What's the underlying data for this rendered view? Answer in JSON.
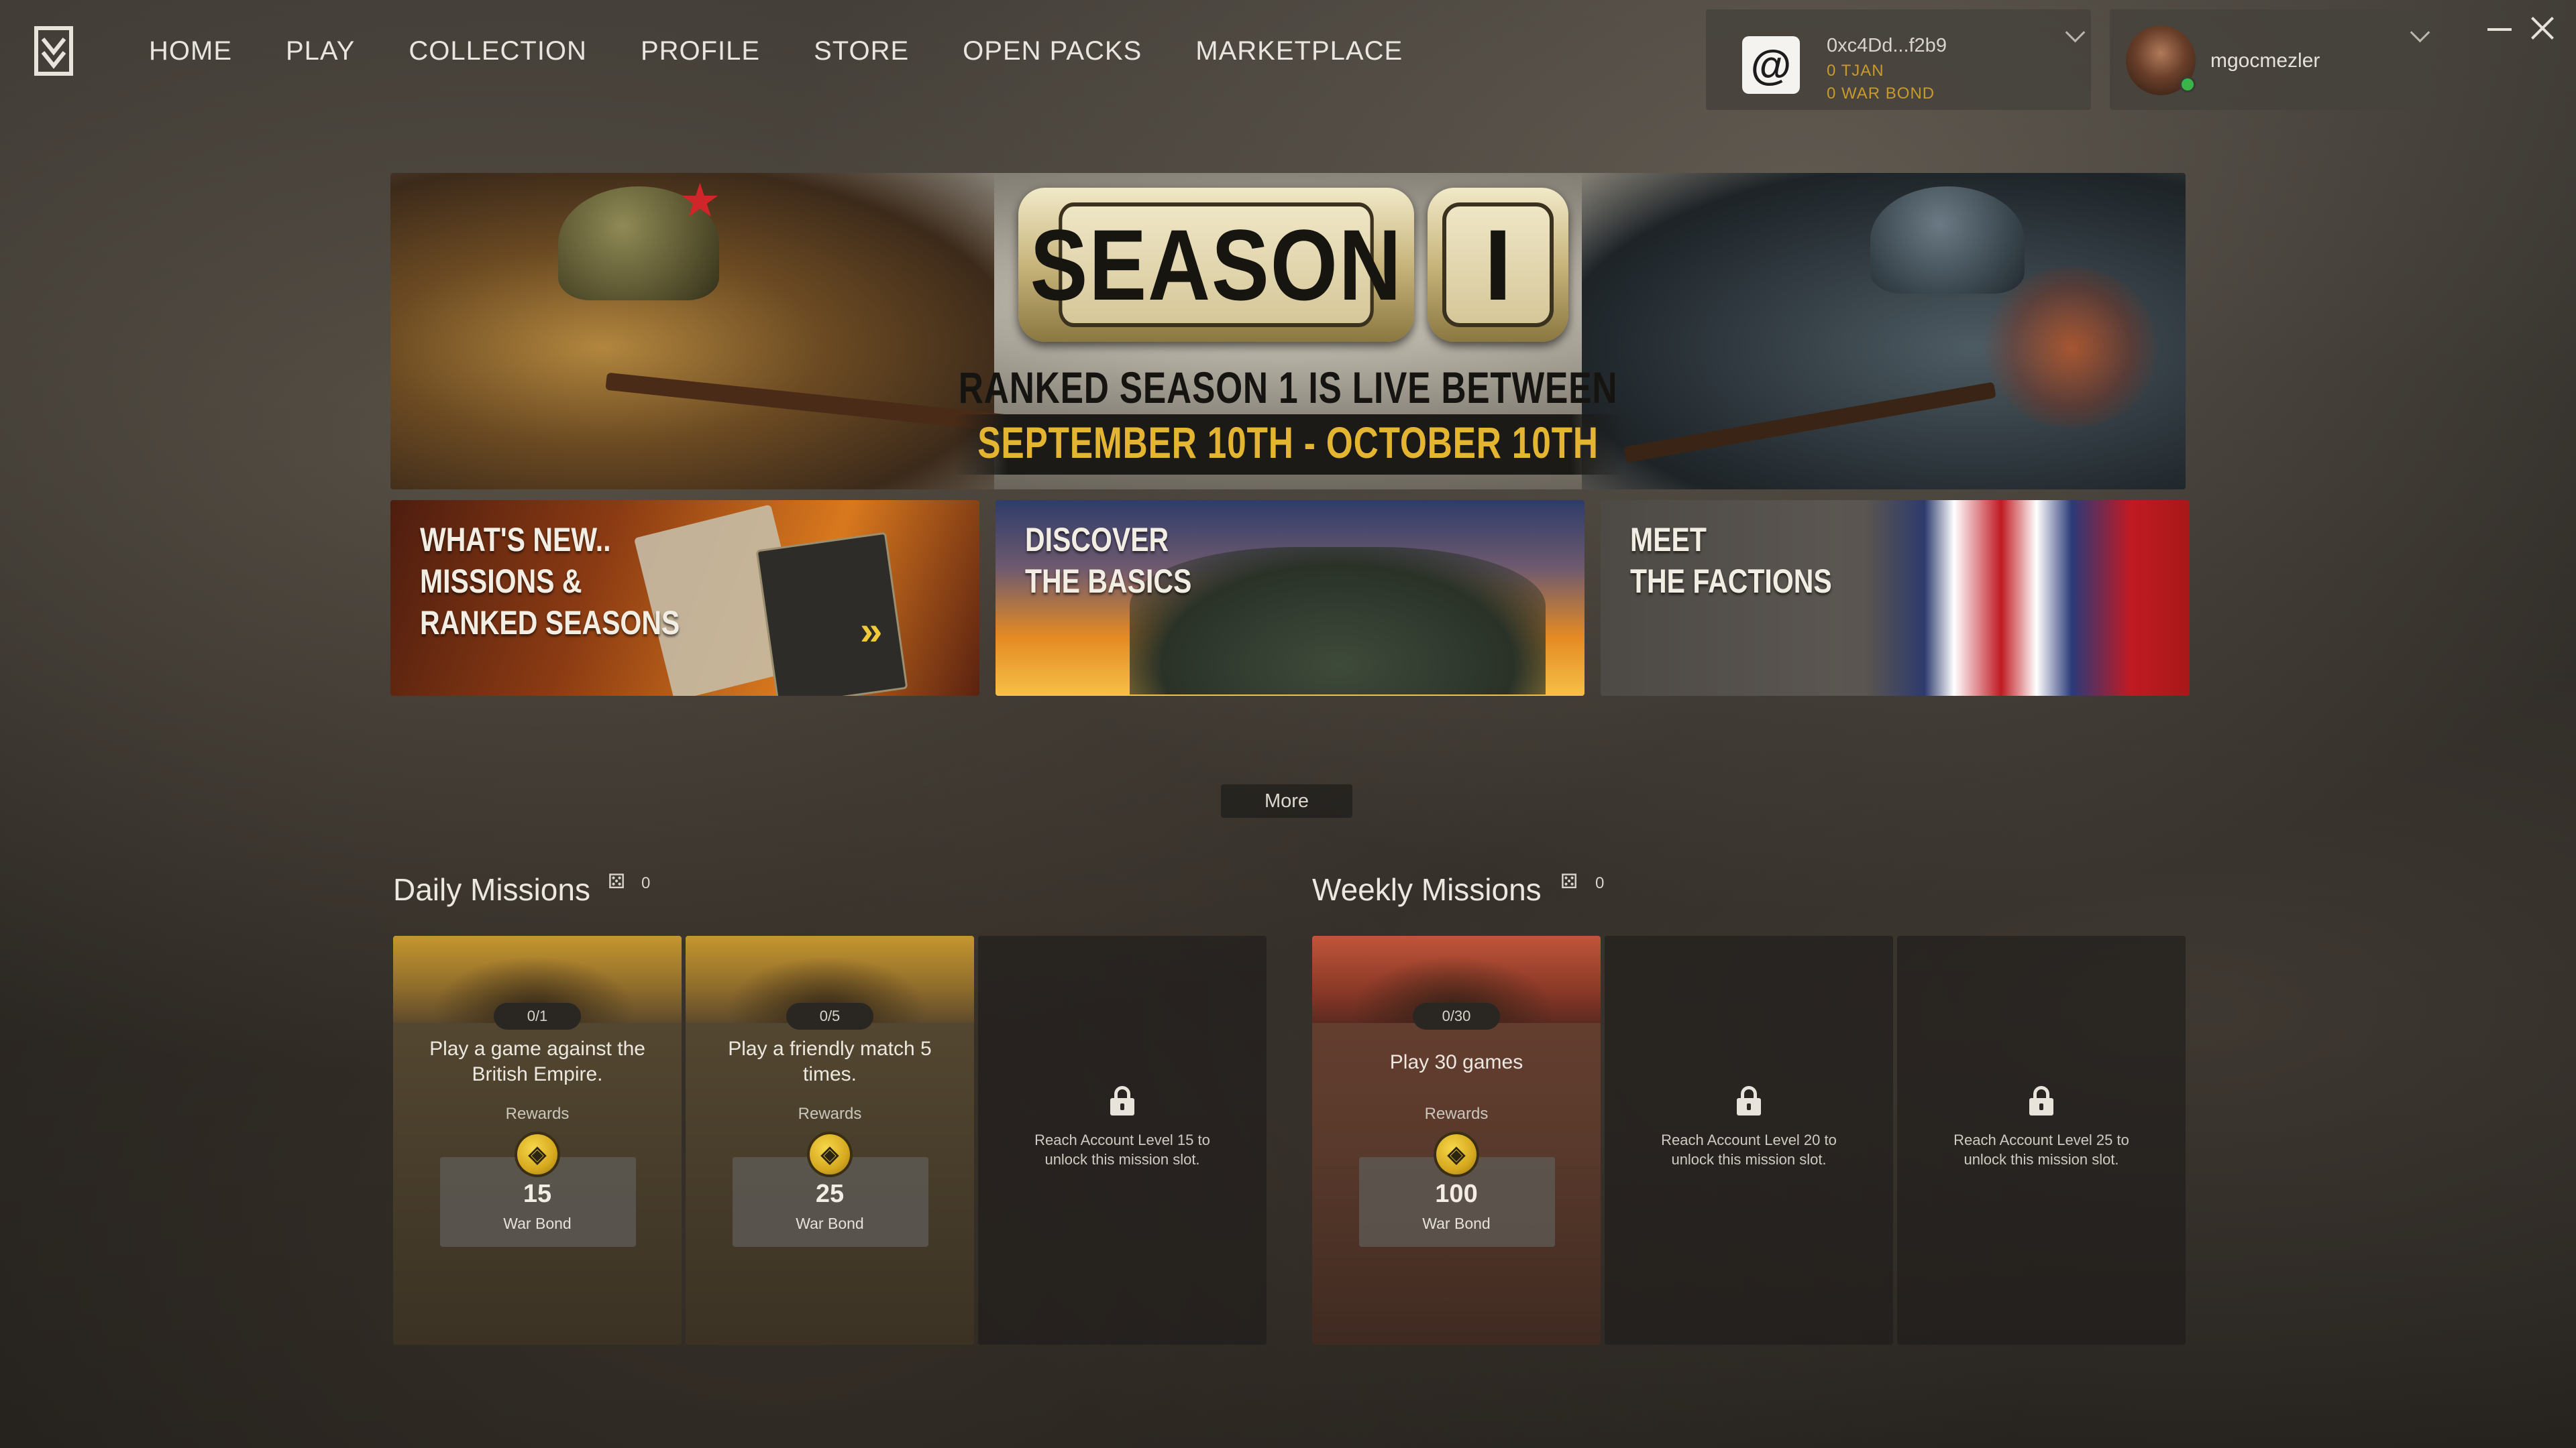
{
  "nav": {
    "items": [
      "HOME",
      "PLAY",
      "COLLECTION",
      "PROFILE",
      "STORE",
      "OPEN PACKS",
      "MARKETPLACE"
    ]
  },
  "wallet": {
    "icon": "at-sign-icon",
    "address": "0xc4Dd...f2b9",
    "tjan": "0 TJAN",
    "war_bond": "0 WAR BOND",
    "accent_color": "#c89a2c"
  },
  "user": {
    "name": "mgocmezler",
    "status_color": "#39b54a"
  },
  "hero": {
    "season_word": "SEASON",
    "season_number": "I",
    "headline": "RANKED SEASON 1 IS LIVE BETWEEN",
    "dates": "SEPTEMBER 10TH - OCTOBER 10TH"
  },
  "cards": [
    {
      "title_lines": [
        "WHAT'S NEW..",
        "MISSIONS &",
        "RANKED SEASONS"
      ]
    },
    {
      "title_lines": [
        "DISCOVER",
        "THE BASICS"
      ]
    },
    {
      "title_lines": [
        "MEET",
        "THE FACTIONS"
      ]
    }
  ],
  "more_label": "More",
  "daily": {
    "title": "Daily Missions",
    "count": "0",
    "missions": [
      {
        "progress": "0/1",
        "desc": "Play a game against the British Empire.",
        "rewards_label": "Rewards",
        "amount": "15",
        "currency": "War Bond"
      },
      {
        "progress": "0/5",
        "desc": "Play a friendly match 5 times.",
        "rewards_label": "Rewards",
        "amount": "25",
        "currency": "War Bond"
      },
      {
        "locked_msg": "Reach Account Level 15 to unlock this mission slot."
      }
    ]
  },
  "weekly": {
    "title": "Weekly Missions",
    "count": "0",
    "missions": [
      {
        "progress": "0/30",
        "desc": "Play 30 games",
        "rewards_label": "Rewards",
        "amount": "100",
        "currency": "War Bond"
      },
      {
        "locked_msg": "Reach Account Level 20 to unlock this mission slot."
      },
      {
        "locked_msg": "Reach Account Level 25 to unlock this mission slot."
      }
    ]
  }
}
